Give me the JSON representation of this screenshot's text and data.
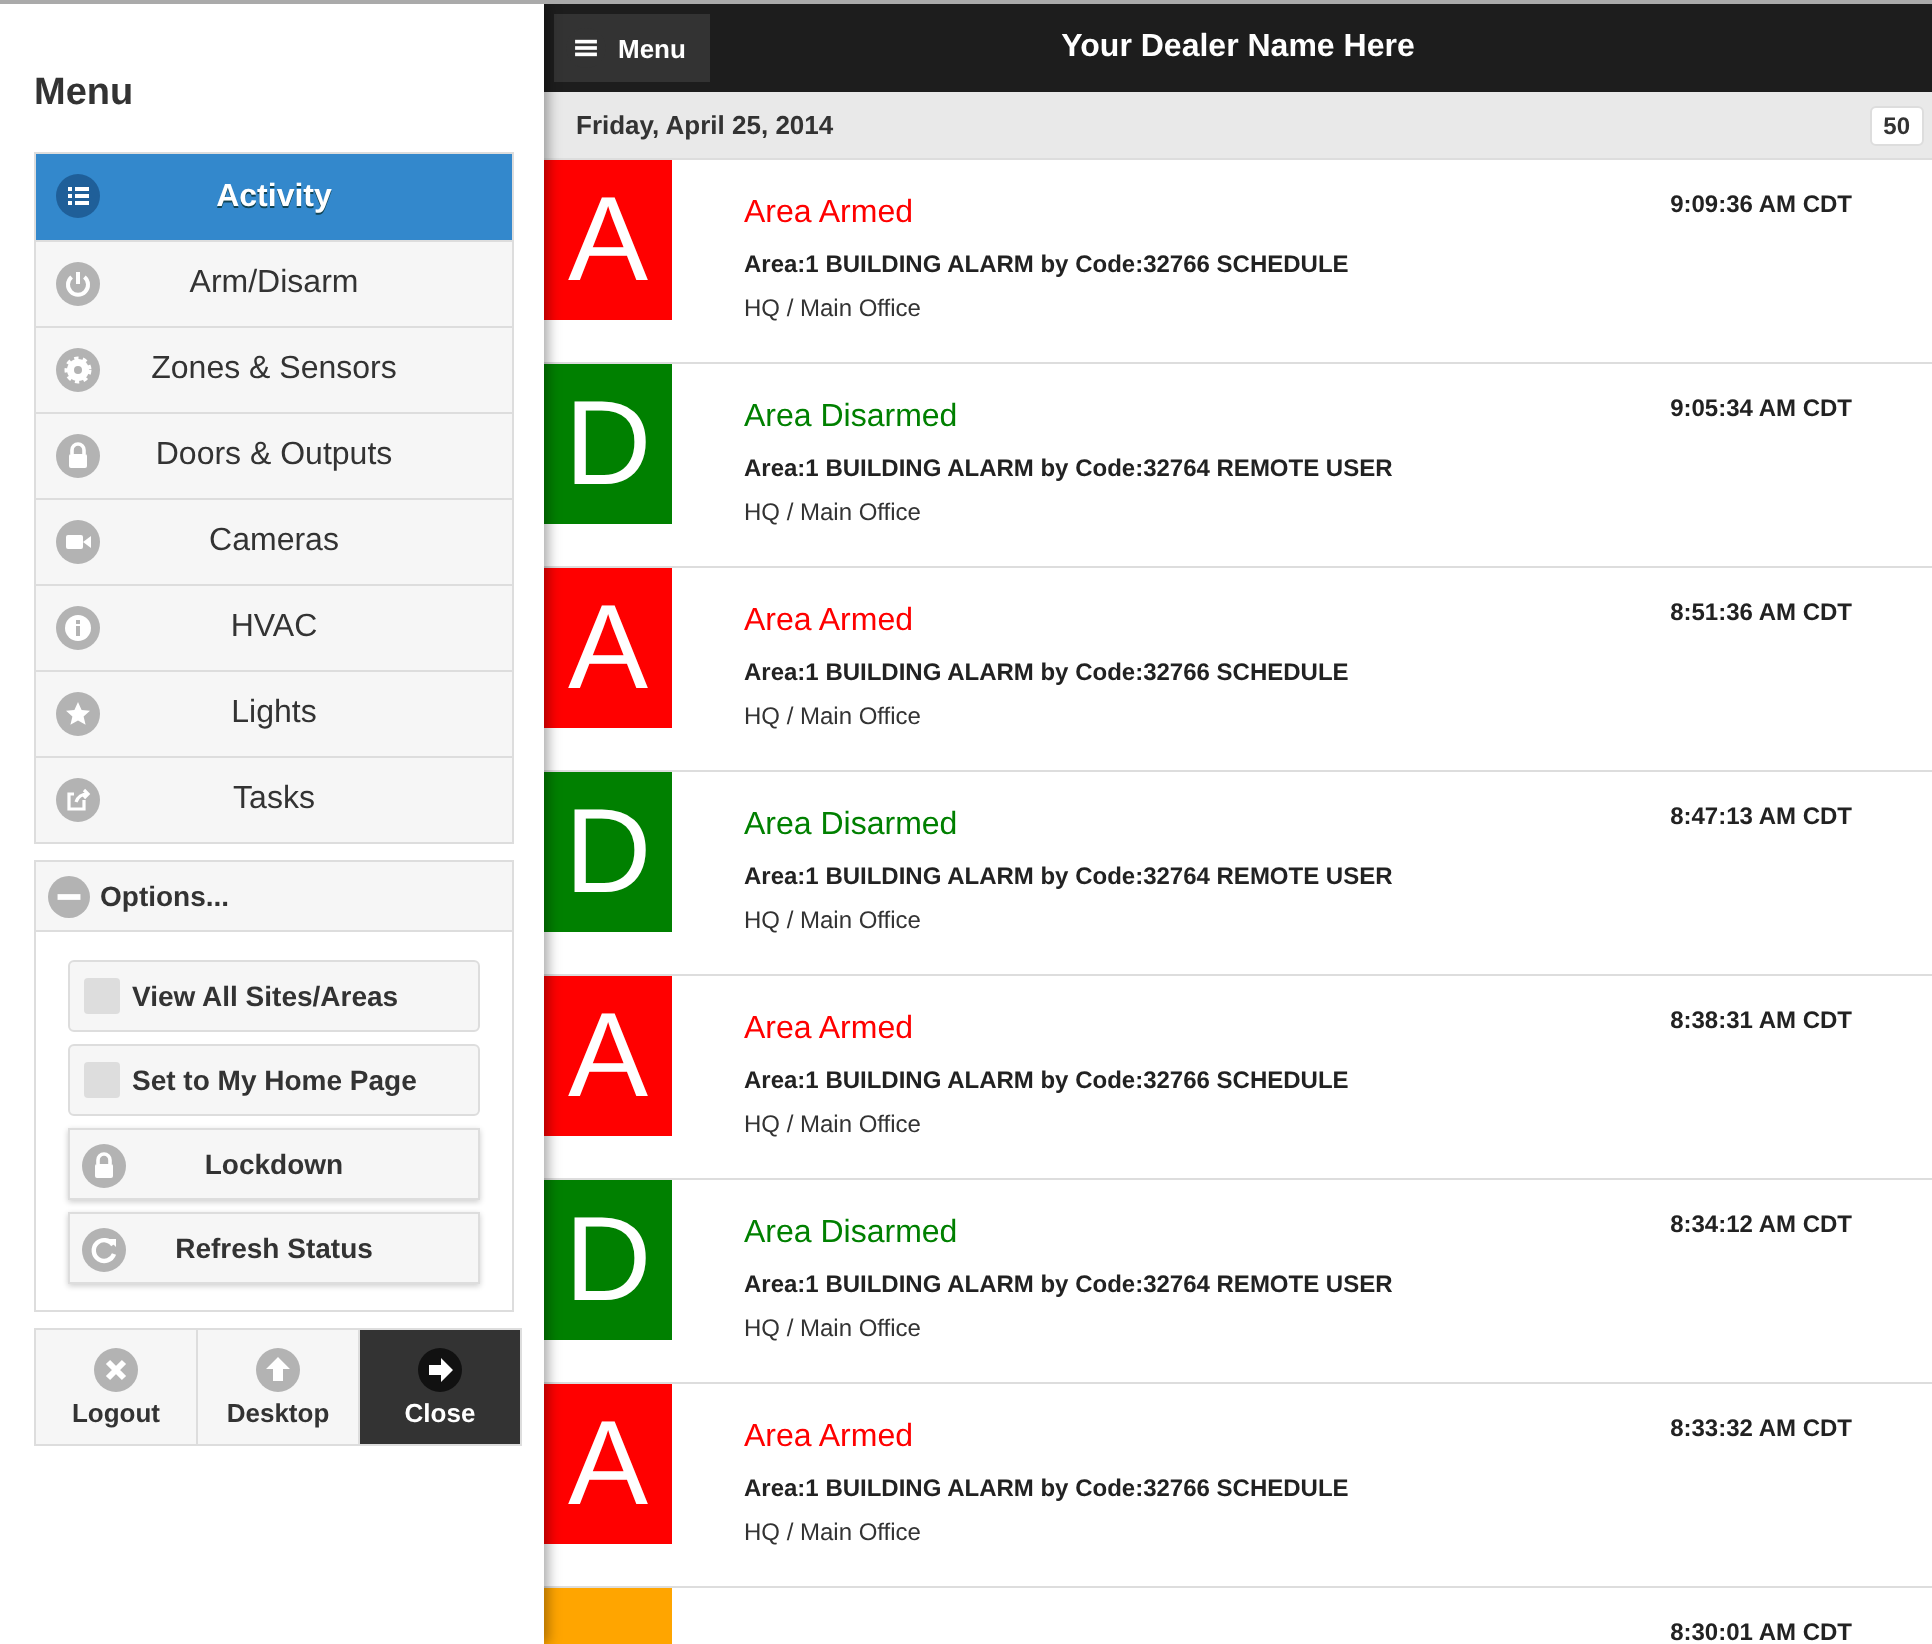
{
  "sidebar": {
    "title": "Menu",
    "items": [
      {
        "label": "Activity",
        "selected": true
      },
      {
        "label": "Arm/Disarm",
        "selected": false
      },
      {
        "label": "Zones & Sensors",
        "selected": false
      },
      {
        "label": "Doors & Outputs",
        "selected": false
      },
      {
        "label": "Cameras",
        "selected": false
      },
      {
        "label": "HVAC",
        "selected": false
      },
      {
        "label": "Lights",
        "selected": false
      },
      {
        "label": "Tasks",
        "selected": false
      }
    ],
    "options": {
      "label": "Options...",
      "expanded": true,
      "items": [
        {
          "kind": "checkbox",
          "label": "View All Sites/Areas",
          "checked": false
        },
        {
          "kind": "checkbox",
          "label": "Set to My Home Page",
          "checked": false
        },
        {
          "kind": "button",
          "label": "Lockdown"
        },
        {
          "kind": "button",
          "label": "Refresh Status"
        }
      ]
    },
    "footer": [
      {
        "label": "Logout",
        "selected": false
      },
      {
        "label": "Desktop",
        "selected": false
      },
      {
        "label": "Close",
        "selected": true
      }
    ]
  },
  "header": {
    "menu_button": "Menu",
    "title": "Your Dealer Name Here"
  },
  "date_bar": {
    "date": "Friday, April 25, 2014",
    "count": "50"
  },
  "events": [
    {
      "letter": "A",
      "title": "Area Armed",
      "detail": "Area:1 BUILDING ALARM by Code:32766 SCHEDULE",
      "location": "HQ / Main Office",
      "time": "9:09:36 AM CDT",
      "color": "#ff0000"
    },
    {
      "letter": "D",
      "title": "Area Disarmed",
      "detail": "Area:1 BUILDING ALARM by Code:32764 REMOTE USER",
      "location": "HQ / Main Office",
      "time": "9:05:34 AM CDT",
      "color": "#008000"
    },
    {
      "letter": "A",
      "title": "Area Armed",
      "detail": "Area:1 BUILDING ALARM by Code:32766 SCHEDULE",
      "location": "HQ / Main Office",
      "time": "8:51:36 AM CDT",
      "color": "#ff0000"
    },
    {
      "letter": "D",
      "title": "Area Disarmed",
      "detail": "Area:1 BUILDING ALARM by Code:32764 REMOTE USER",
      "location": "HQ / Main Office",
      "time": "8:47:13 AM CDT",
      "color": "#008000"
    },
    {
      "letter": "A",
      "title": "Area Armed",
      "detail": "Area:1 BUILDING ALARM by Code:32766 SCHEDULE",
      "location": "HQ / Main Office",
      "time": "8:38:31 AM CDT",
      "color": "#ff0000"
    },
    {
      "letter": "D",
      "title": "Area Disarmed",
      "detail": "Area:1 BUILDING ALARM by Code:32764 REMOTE USER",
      "location": "HQ / Main Office",
      "time": "8:34:12 AM CDT",
      "color": "#008000"
    },
    {
      "letter": "A",
      "title": "Area Armed",
      "detail": "Area:1 BUILDING ALARM by Code:32766 SCHEDULE",
      "location": "HQ / Main Office",
      "time": "8:33:32 AM CDT",
      "color": "#ff0000"
    },
    {
      "time": "8:30:01 AM CDT",
      "color": "#ffa500"
    }
  ]
}
